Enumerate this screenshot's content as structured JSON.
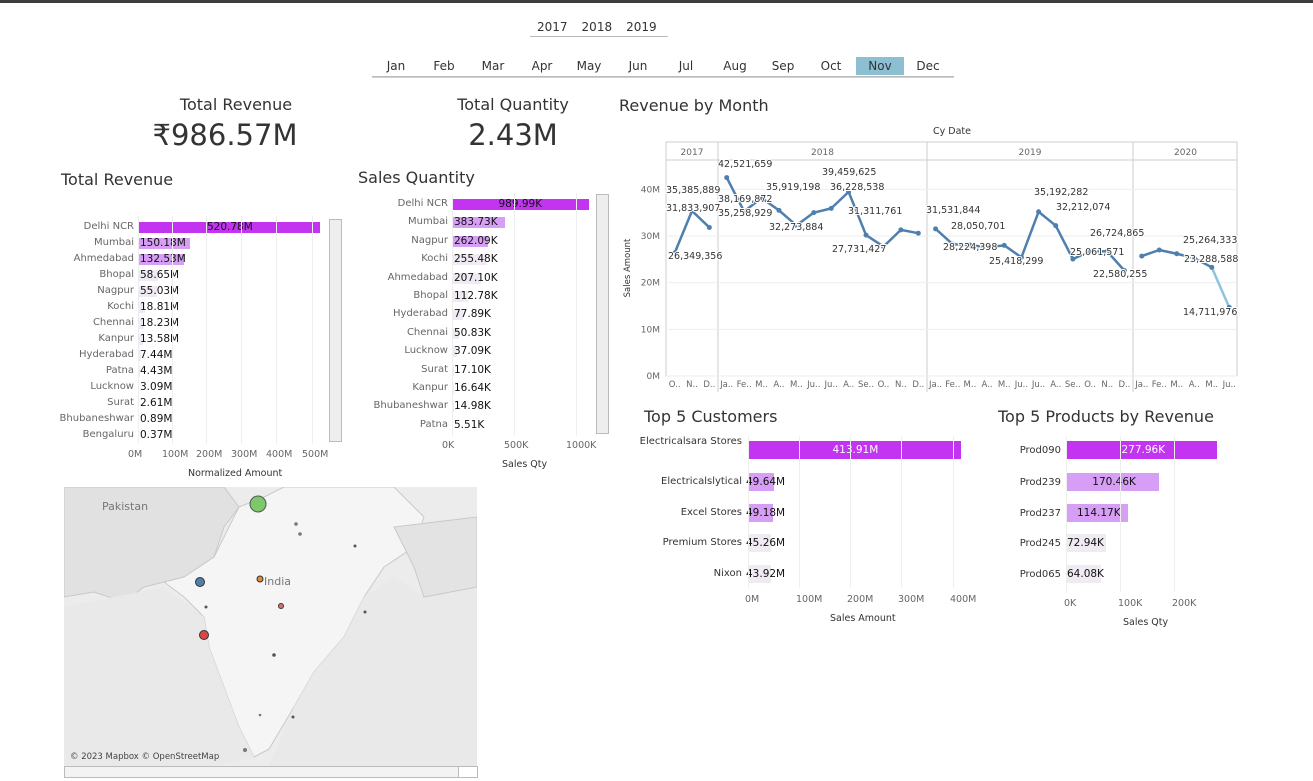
{
  "filters": {
    "years": [
      "2017",
      "2018",
      "2019"
    ],
    "months": [
      "Jan",
      "Feb",
      "Mar",
      "Apr",
      "May",
      "Jun",
      "Jul",
      "Aug",
      "Sep",
      "Oct",
      "Nov",
      "Dec"
    ],
    "selected_month": "Nov"
  },
  "kpis": {
    "total_revenue": {
      "title": "Total Revenue",
      "value": "₹986.57M"
    },
    "total_quantity": {
      "title": "Total Quantity",
      "value": "2.43M"
    }
  },
  "revenue_by_city": {
    "title": "Total Revenue",
    "xlabel": "Normalized Amount",
    "ticks": [
      "0M",
      "100M",
      "200M",
      "300M",
      "400M",
      "500M"
    ],
    "items": [
      {
        "label": "Delhi NCR",
        "value": 520.78,
        "text": "520.78M"
      },
      {
        "label": "Mumbai",
        "value": 150.18,
        "text": "150.18M"
      },
      {
        "label": "Ahmedabad",
        "value": 132.53,
        "text": "132.53M"
      },
      {
        "label": "Bhopal",
        "value": 58.65,
        "text": "58.65M"
      },
      {
        "label": "Nagpur",
        "value": 55.03,
        "text": "55.03M"
      },
      {
        "label": "Kochi",
        "value": 18.81,
        "text": "18.81M"
      },
      {
        "label": "Chennai",
        "value": 18.23,
        "text": "18.23M"
      },
      {
        "label": "Kanpur",
        "value": 13.58,
        "text": "13.58M"
      },
      {
        "label": "Hyderabad",
        "value": 7.44,
        "text": "7.44M"
      },
      {
        "label": "Patna",
        "value": 4.43,
        "text": "4.43M"
      },
      {
        "label": "Lucknow",
        "value": 3.09,
        "text": "3.09M"
      },
      {
        "label": "Surat",
        "value": 2.61,
        "text": "2.61M"
      },
      {
        "label": "Bhubaneshwar",
        "value": 0.89,
        "text": "0.89M"
      },
      {
        "label": "Bengaluru",
        "value": 0.37,
        "text": "0.37M"
      }
    ]
  },
  "sales_quantity": {
    "title": "Sales Quantity",
    "xlabel": "Sales Qty",
    "ticks": [
      "0K",
      "500K",
      "1000K"
    ],
    "items": [
      {
        "label": "Delhi NCR",
        "value": 989.99,
        "text": "989.99K"
      },
      {
        "label": "Mumbai",
        "value": 383.73,
        "text": "383.73K"
      },
      {
        "label": "Nagpur",
        "value": 262.09,
        "text": "262.09K"
      },
      {
        "label": "Kochi",
        "value": 255.48,
        "text": "255.48K"
      },
      {
        "label": "Ahmedabad",
        "value": 207.1,
        "text": "207.10K"
      },
      {
        "label": "Bhopal",
        "value": 112.78,
        "text": "112.78K"
      },
      {
        "label": "Hyderabad",
        "value": 77.89,
        "text": "77.89K"
      },
      {
        "label": "Chennai",
        "value": 50.83,
        "text": "50.83K"
      },
      {
        "label": "Lucknow",
        "value": 37.09,
        "text": "37.09K"
      },
      {
        "label": "Surat",
        "value": 17.1,
        "text": "17.10K"
      },
      {
        "label": "Kanpur",
        "value": 16.64,
        "text": "16.64K"
      },
      {
        "label": "Bhubaneshwar",
        "value": 14.98,
        "text": "14.98K"
      },
      {
        "label": "Patna",
        "value": 5.51,
        "text": "5.51K"
      }
    ]
  },
  "revenue_by_month": {
    "title": "Revenue by Month",
    "header": "Cy Date",
    "ylabel": "Sales Amount",
    "yticks": [
      "0M",
      "10M",
      "20M",
      "30M",
      "40M"
    ],
    "years": [
      "2017",
      "2018",
      "2019",
      "2020"
    ],
    "month_ticks": {
      "2017": [
        "O..",
        "N..",
        "D.."
      ],
      "2018": [
        "Ja..",
        "Fe..",
        "M..",
        "A..",
        "M..",
        "Ju..",
        "Ju..",
        "A..",
        "Se..",
        "O..",
        "N..",
        "D.."
      ],
      "2019": [
        "Ja..",
        "Fe..",
        "M..",
        "A..",
        "M..",
        "Ju..",
        "Ju..",
        "A..",
        "Se..",
        "O..",
        "N..",
        "D.."
      ],
      "2020": [
        "Ja..",
        "Fe..",
        "M..",
        "A..",
        "M..",
        "Ju.."
      ]
    },
    "labels": [
      "35,385,889",
      "31,833,907",
      "26,349,356",
      "42,521,659",
      "38,169,872",
      "35,258,929",
      "35,919,198",
      "32,273,884",
      "39,459,625",
      "36,228,538",
      "27,731,427",
      "31,311,761",
      "31,531,844",
      "28,050,701",
      "28,224,398",
      "25,418,299",
      "35,192,282",
      "32,212,074",
      "25,061,571",
      "26,724,865",
      "22,580,255",
      "25,264,333",
      "23,288,588",
      "14,711,976"
    ]
  },
  "chart_data": [
    {
      "type": "line",
      "title": "Revenue by Month",
      "xlabel": "Cy Date",
      "ylabel": "Sales Amount",
      "ylim": [
        0,
        45000000
      ],
      "series": [
        {
          "values": [
            26349356,
            35385889,
            31833907
          ]
        },
        {
          "values": [
            42521659,
            35258929,
            38169872,
            35500000,
            32273884,
            35000000,
            35919198,
            39459625,
            30200000,
            27731427,
            31311761,
            30600000
          ]
        },
        {
          "values": [
            31531844,
            28224398,
            28050701,
            27600000,
            28000000,
            25418299,
            35192282,
            32212074,
            25061571,
            26724865,
            26700000,
            22580255
          ]
        },
        {
          "values": [
            25700000,
            27000000,
            26200000,
            25264333,
            23288588,
            14711976
          ]
        }
      ],
      "x_years": [
        "2017",
        "2017",
        "2017",
        "2018 x12",
        "2019 x12",
        "2020 x6"
      ]
    },
    {
      "type": "bar",
      "title": "Top 5 Customers",
      "xlabel": "Sales Amount",
      "categories": [
        "Electricalsara Stores",
        "Electricalslytical",
        "Excel Stores",
        "Premium Stores",
        "Nixon"
      ],
      "values": [
        413.91,
        49.64,
        49.18,
        45.26,
        43.92
      ],
      "xlim": [
        0,
        450
      ]
    },
    {
      "type": "bar",
      "title": "Top 5 Products by Revenue",
      "xlabel": "Sales Qty",
      "categories": [
        "Prod090",
        "Prod239",
        "Prod237",
        "Prod245",
        "Prod065"
      ],
      "values": [
        277.96,
        170.46,
        114.17,
        72.94,
        64.08
      ],
      "xlim": [
        0,
        300
      ]
    }
  ],
  "top_customers": {
    "title": "Top 5 Customers",
    "xlabel": "Sales Amount",
    "ticks": [
      "0M",
      "100M",
      "200M",
      "300M",
      "400M"
    ],
    "items": [
      {
        "label": "Electricalsara Stores",
        "text": "413.91M"
      },
      {
        "label": "Electricalslytical",
        "text": "49.64M"
      },
      {
        "label": "Excel Stores",
        "text": "49.18M"
      },
      {
        "label": "Premium Stores",
        "text": "45.26M"
      },
      {
        "label": "Nixon",
        "text": "43.92M"
      }
    ]
  },
  "top_products": {
    "title": "Top 5 Products by Revenue",
    "xlabel": "Sales Qty",
    "ticks": [
      "0K",
      "100K",
      "200K"
    ],
    "items": [
      {
        "label": "Prod090",
        "text": "277.96K"
      },
      {
        "label": "Prod239",
        "text": "170.46K"
      },
      {
        "label": "Prod237",
        "text": "114.17K"
      },
      {
        "label": "Prod245",
        "text": "72.94K"
      },
      {
        "label": "Prod065",
        "text": "64.08K"
      }
    ]
  },
  "map": {
    "country_label": "India",
    "neighbor_label": "Pakistan",
    "attribution": "© 2023 Mapbox © OpenStreetMap"
  },
  "colors": {
    "top_bar": "#c234f0",
    "mid_bar": "#d79ef5",
    "low_bar": "#f0eaf3",
    "line": "#4f7fad",
    "selected_month": "#8bbfd1"
  }
}
